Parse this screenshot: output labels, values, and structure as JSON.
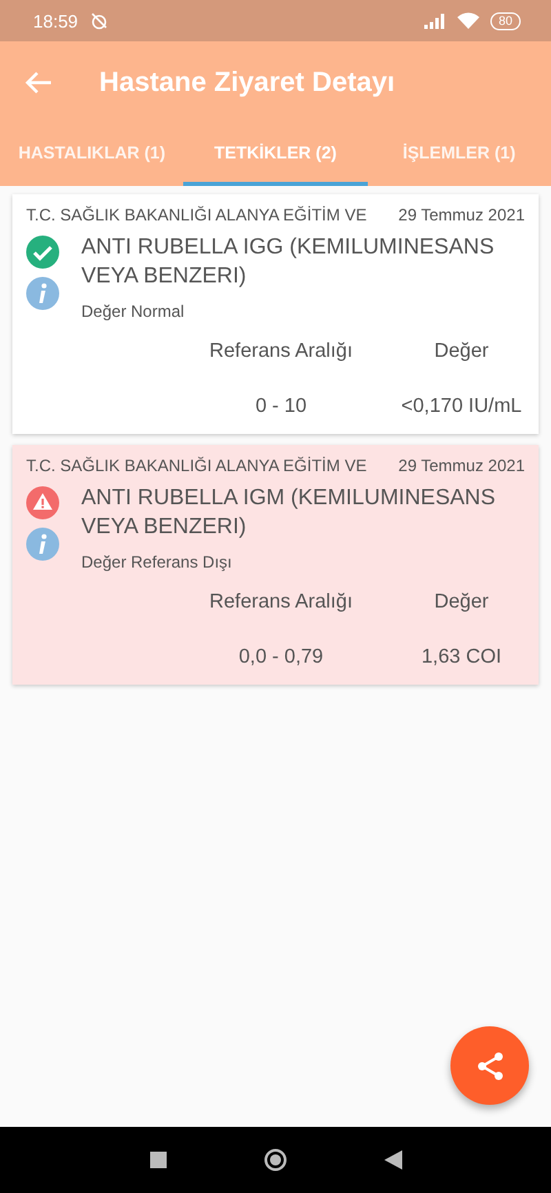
{
  "status_bar": {
    "time": "18:59",
    "battery": "80"
  },
  "app_bar": {
    "title": "Hastane Ziyaret Detayı"
  },
  "tabs": [
    {
      "label": "HASTALIKLAR (1)",
      "selected": false
    },
    {
      "label": "TETKİKLER (2)",
      "selected": true
    },
    {
      "label": "İŞLEMLER (1)",
      "selected": false
    }
  ],
  "tests": [
    {
      "hospital": "T.C. SAĞLIK BAKANLIĞI ALANYA EĞİTİM VE",
      "date": "29 Temmuz 2021",
      "name": "ANTI RUBELLA IGG (KEMILUMINESANS VEYA BENZERI)",
      "status": "Değer Normal",
      "kind": "normal",
      "range_label": "Referans Aralığı",
      "value_label": "Değer",
      "range": "0 - 10",
      "value": "<0,170 IU/mL"
    },
    {
      "hospital": "T.C. SAĞLIK BAKANLIĞI ALANYA EĞİTİM VE",
      "date": "29 Temmuz 2021",
      "name": "ANTI RUBELLA IGM (KEMILUMINESANS VEYA BENZERI)",
      "status": "Değer Referans Dışı",
      "kind": "abnormal",
      "range_label": "Referans Aralığı",
      "value_label": "Değer",
      "range": "0,0 - 0,79",
      "value": "1,63 COI"
    }
  ]
}
